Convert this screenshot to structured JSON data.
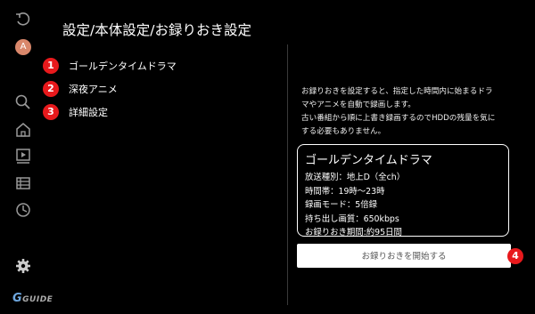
{
  "header": {
    "title": "設定/本体設定/お録りおき設定"
  },
  "sidebar": {
    "avatar_letter": "A",
    "logo": "GUIDE",
    "icons": [
      "undo-icon",
      "avatar",
      "search-icon",
      "home-icon",
      "playlist-icon",
      "list-icon",
      "clock-icon",
      "gear-icon"
    ]
  },
  "menu": {
    "items": [
      {
        "num": "1",
        "label": "ゴールデンタイムドラマ"
      },
      {
        "num": "2",
        "label": "深夜アニメ"
      },
      {
        "num": "3",
        "label": "詳細設定"
      }
    ]
  },
  "description": {
    "lines": [
      "お録りおきを設定すると、指定した時間内に始まるドラ",
      "マやアニメを自動で録画します。",
      "古い番組から順に上書き録画するのでHDDの残量を気に",
      "する必要もありません。"
    ]
  },
  "info": {
    "title": "ゴールデンタイムドラマ",
    "lines": [
      "放送種別：地上D（全ch）",
      "時間帯：19時〜23時",
      "録画モード：5倍録",
      "持ち出し画質：650kbps",
      "お録りおき期間:約95日間"
    ]
  },
  "action": {
    "start_label": "お録りおきを開始する",
    "num": "4"
  },
  "colors": {
    "badge": "#e8191c",
    "background": "#000000"
  }
}
